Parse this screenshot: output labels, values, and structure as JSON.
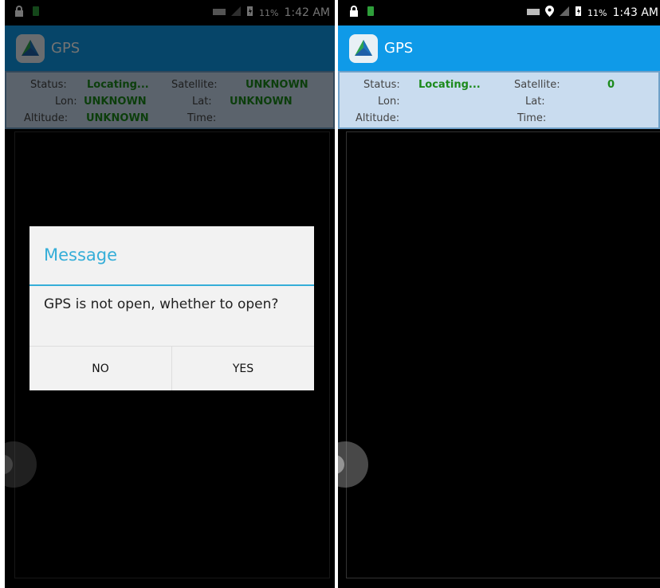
{
  "left_screen": {
    "status_bar": {
      "time": "1:42 AM",
      "battery": "11%"
    },
    "app_title": "GPS",
    "info": {
      "status_label": "Status:",
      "status_value": "Locating...",
      "satellite_label": "Satellite:",
      "satellite_value": "UNKNOWN",
      "lon_label": "Lon:",
      "lon_value": "UNKNOWN",
      "lat_label": "Lat:",
      "lat_value": "UNKNOWN",
      "altitude_label": "Altitude:",
      "altitude_value": "UNKNOWN",
      "time_label": "Time:"
    },
    "dialog": {
      "title": "Message",
      "message": "GPS is not open, whether to open?",
      "no_label": "NO",
      "yes_label": "YES"
    }
  },
  "right_screen": {
    "status_bar": {
      "time": "1:43 AM",
      "battery": "11%"
    },
    "app_title": "GPS",
    "info": {
      "status_label": "Status:",
      "status_value": "Locating...",
      "satellite_label": "Satellite:",
      "satellite_value": "0",
      "lon_label": "Lon:",
      "lat_label": "Lat:",
      "altitude_label": "Altitude:",
      "time_label": "Time:"
    }
  },
  "colors": {
    "appbar_blue": "#0f9ae8",
    "info_panel": "#c9dcef",
    "value_green": "#1b8a1b",
    "dialog_accent": "#35aed8"
  }
}
